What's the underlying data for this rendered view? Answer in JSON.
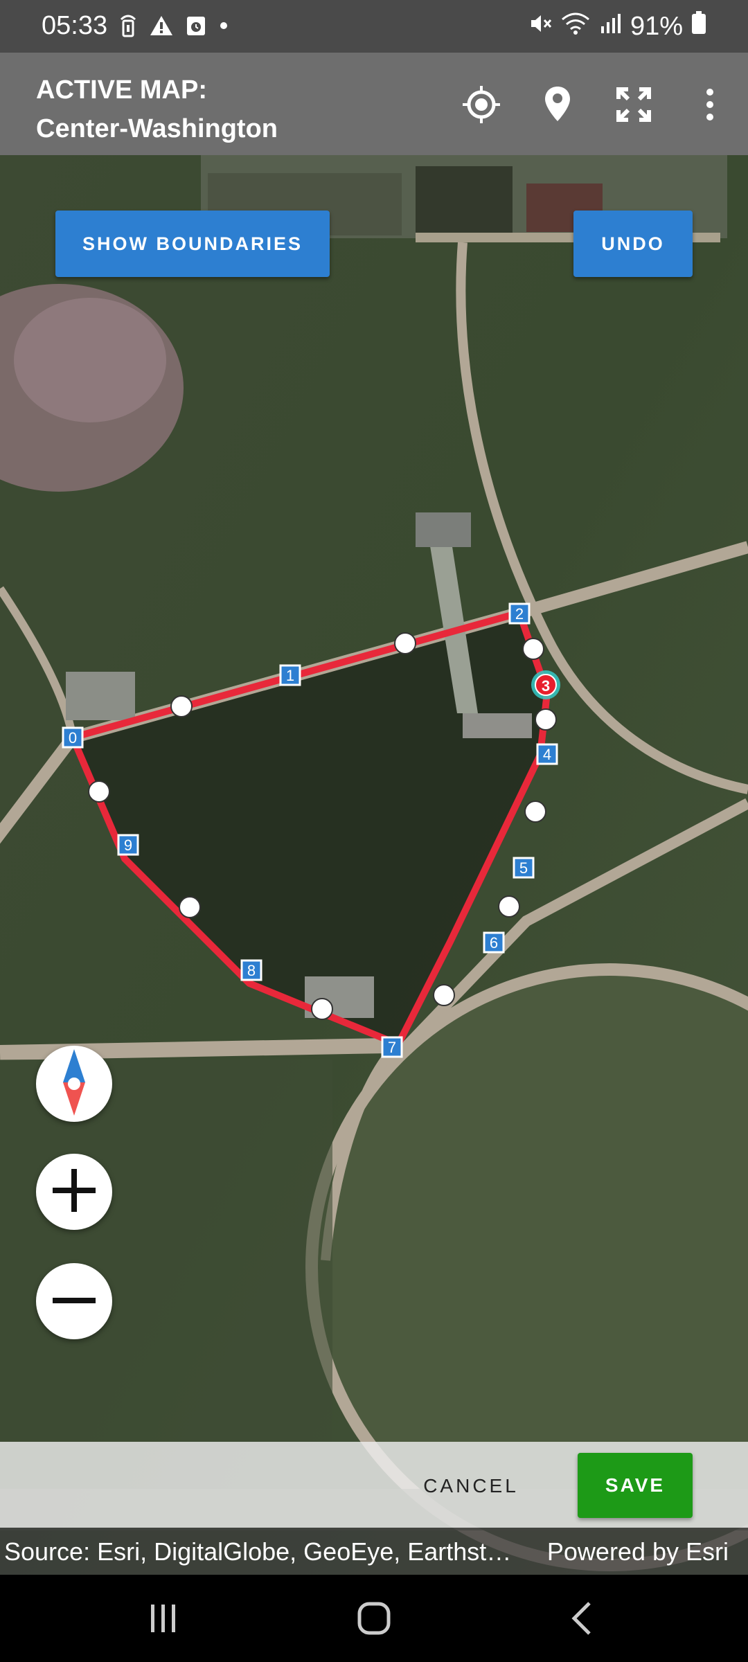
{
  "status_bar": {
    "time": "05:33",
    "battery": "91%"
  },
  "app_bar": {
    "title_line1": "ACTIVE MAP:",
    "title_line2": "Center-Washington"
  },
  "map": {
    "show_boundaries_label": "SHOW BOUNDARIES",
    "undo_label": "UNDO",
    "vertex_labels": [
      "0",
      "1",
      "2",
      "3",
      "4",
      "5",
      "6",
      "7",
      "8",
      "9"
    ],
    "colors": {
      "boundary": "#e8283a",
      "vertex_label_bg": "#2d7fd1",
      "selected_vertex": "#e81e2c",
      "selected_halo": "#36c9c6"
    }
  },
  "actions": {
    "cancel_label": "CANCEL",
    "save_label": "SAVE"
  },
  "attribution": {
    "source": "Source: Esri, DigitalGlobe, GeoEye, Earthstar Geographics",
    "powered_by": "Powered by Esri"
  },
  "icons": {
    "status": [
      "wireless-icon",
      "warning-icon",
      "calendar-icon",
      "dot-icon",
      "mute-icon",
      "wifi-icon",
      "signal-icon",
      "battery-icon"
    ],
    "app_bar": [
      "gps-crosshair-icon",
      "map-pin-icon",
      "fullscreen-icon",
      "more-vert-icon"
    ],
    "map_controls": [
      "compass-icon",
      "zoom-in-icon",
      "zoom-out-icon"
    ],
    "nav": [
      "recents-icon",
      "home-icon",
      "back-icon"
    ]
  }
}
